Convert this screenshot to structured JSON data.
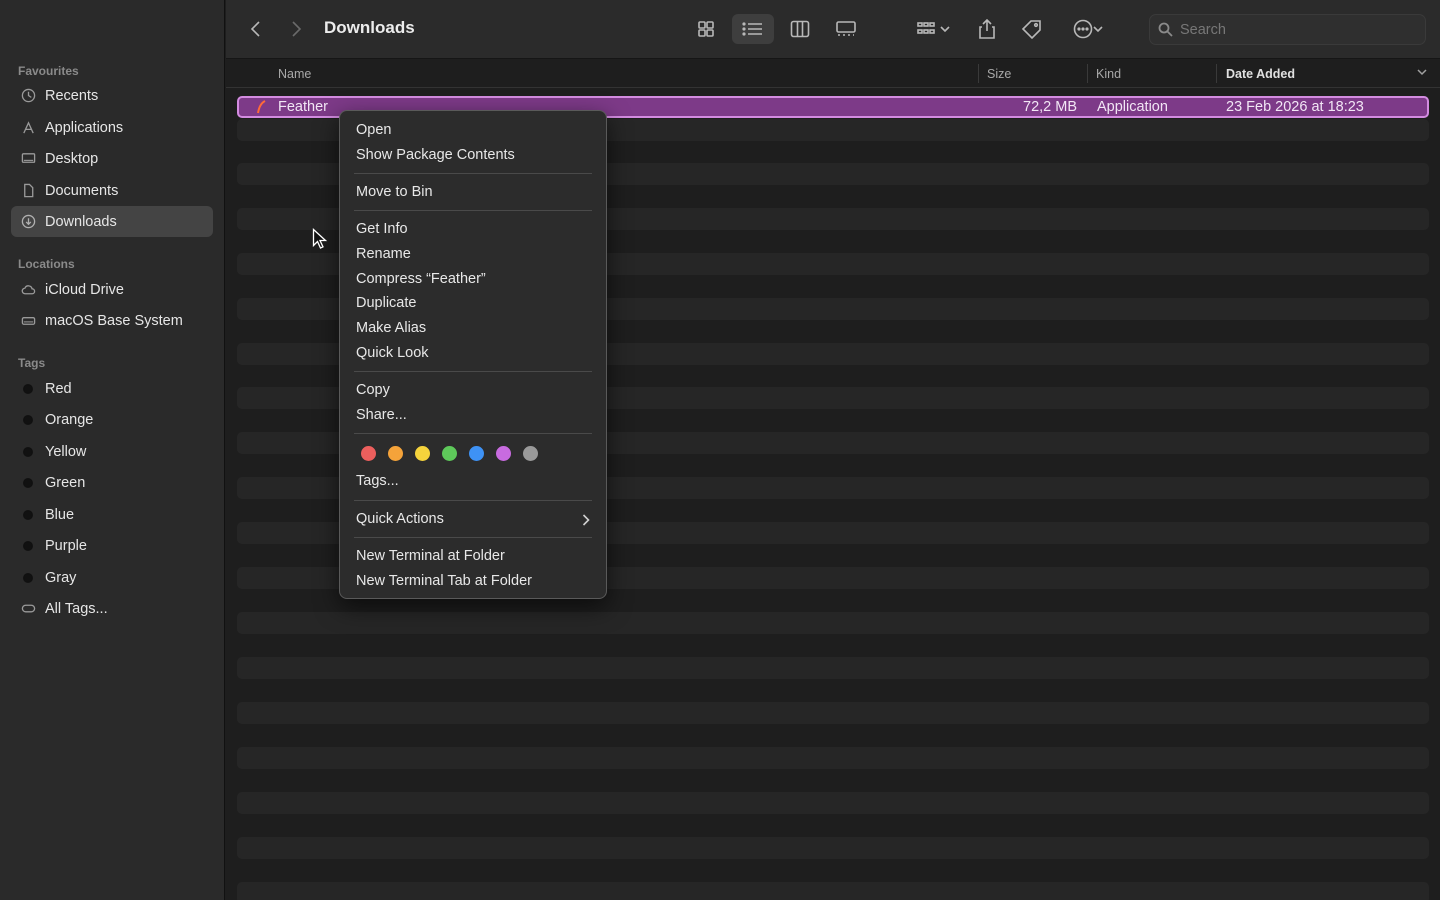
{
  "sidebar": {
    "favourites_title": "Favourites",
    "favourites": [
      {
        "label": "Recents",
        "icon": "clock-icon"
      },
      {
        "label": "Applications",
        "icon": "applications-icon"
      },
      {
        "label": "Desktop",
        "icon": "desktop-icon"
      },
      {
        "label": "Documents",
        "icon": "document-icon"
      },
      {
        "label": "Downloads",
        "icon": "download-icon",
        "active": true
      }
    ],
    "locations_title": "Locations",
    "locations": [
      {
        "label": "iCloud Drive",
        "icon": "cloud-icon"
      },
      {
        "label": "macOS Base System",
        "icon": "drive-icon"
      }
    ],
    "tags_title": "Tags",
    "tags": [
      {
        "label": "Red"
      },
      {
        "label": "Orange"
      },
      {
        "label": "Yellow"
      },
      {
        "label": "Green"
      },
      {
        "label": "Blue"
      },
      {
        "label": "Purple"
      },
      {
        "label": "Gray"
      },
      {
        "label": "All Tags..."
      }
    ]
  },
  "toolbar": {
    "title": "Downloads",
    "search_placeholder": "Search"
  },
  "columns": {
    "name": "Name",
    "size": "Size",
    "kind": "Kind",
    "date_added": "Date Added"
  },
  "file": {
    "name": "Feather",
    "size": "72,2 MB",
    "kind": "Application",
    "date_added": "23 Feb 2026 at 18:23"
  },
  "context_menu": {
    "open": "Open",
    "show_package_contents": "Show Package Contents",
    "move_to_bin": "Move to Bin",
    "get_info": "Get Info",
    "rename": "Rename",
    "compress": "Compress “Feather”",
    "duplicate": "Duplicate",
    "make_alias": "Make Alias",
    "quick_look": "Quick Look",
    "copy": "Copy",
    "share": "Share...",
    "tag_colors": [
      "#ec5f5d",
      "#f5a33a",
      "#f5d33c",
      "#5ec95a",
      "#3e92f5",
      "#c86be0",
      "#9a9a9a"
    ],
    "tags": "Tags...",
    "quick_actions": "Quick Actions",
    "new_terminal": "New Terminal at Folder",
    "new_terminal_tab": "New Terminal Tab at Folder"
  }
}
